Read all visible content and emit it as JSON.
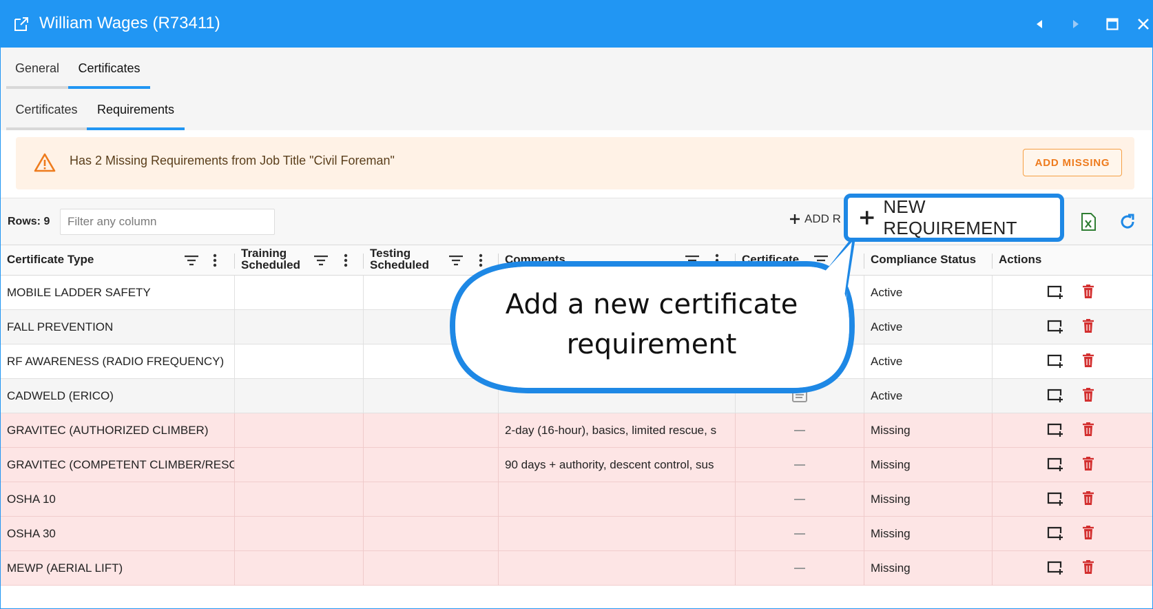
{
  "window": {
    "title": "William Wages (R73411)",
    "accent": "#2196F3"
  },
  "tabs_primary": [
    {
      "label": "General",
      "active": false
    },
    {
      "label": "Certificates",
      "active": true
    }
  ],
  "tabs_secondary": [
    {
      "label": "Certificates",
      "active": false
    },
    {
      "label": "Requirements",
      "active": true
    }
  ],
  "alert": {
    "message": "Has 2 Missing Requirements from Job Title \"Civil Foreman\"",
    "action_label": "ADD MISSING",
    "icon": "warning-icon"
  },
  "toolbar": {
    "rows_label": "Rows: 9",
    "filter_placeholder": "Filter any column",
    "add_label": "ADD R",
    "new_requirement_label": "NEW REQUIREMENT",
    "export_icon": "excel-icon",
    "refresh_icon": "refresh-icon"
  },
  "table": {
    "columns": [
      "Certificate Type",
      "Training Scheduled",
      "Testing Scheduled",
      "Comments",
      "Certificate",
      "Compliance Status",
      "Actions"
    ],
    "column_lines": {
      "training_1": "Training",
      "training_2": "Scheduled",
      "testing_1": "Testing",
      "testing_2": "Scheduled"
    },
    "rows": [
      {
        "type": "MOBILE LADDER SAFETY",
        "training": "",
        "testing": "",
        "comments": "",
        "certificate": "",
        "status": "Active"
      },
      {
        "type": "FALL PREVENTION",
        "training": "",
        "testing": "",
        "comments": "",
        "certificate": "",
        "status": "Active"
      },
      {
        "type": "RF AWARENESS (RADIO FREQUENCY)",
        "training": "",
        "testing": "",
        "comments": "",
        "certificate": "",
        "status": "Active"
      },
      {
        "type": "CADWELD (ERICO)",
        "training": "",
        "testing": "",
        "comments": "",
        "certificate": "document-icon",
        "status": "Active"
      },
      {
        "type": "GRAVITEC (AUTHORIZED CLIMBER)",
        "training": "",
        "testing": "",
        "comments": "2-day (16-hour), basics, limited rescue, s",
        "certificate": "—",
        "status": "Missing"
      },
      {
        "type": "GRAVITEC (COMPETENT CLIMBER/RESCU",
        "training": "",
        "testing": "",
        "comments": "90 days + authority, descent control, sus",
        "certificate": "—",
        "status": "Missing"
      },
      {
        "type": "OSHA 10",
        "training": "",
        "testing": "",
        "comments": "",
        "certificate": "—",
        "status": "Missing"
      },
      {
        "type": "OSHA 30",
        "training": "",
        "testing": "",
        "comments": "",
        "certificate": "—",
        "status": "Missing"
      },
      {
        "type": "MEWP (AERIAL LIFT)",
        "training": "",
        "testing": "",
        "comments": "",
        "certificate": "—",
        "status": "Missing"
      }
    ]
  },
  "callout": {
    "text_line1": "Add a new certificate",
    "text_line2": "requirement",
    "color": "#1E88E5"
  },
  "colors": {
    "missing_row": "#FDE5E5",
    "alert_bg": "#FFF2E6",
    "alert_accent": "#EE7B1D",
    "delete": "#D32F2F",
    "excel": "#2E7D32"
  }
}
